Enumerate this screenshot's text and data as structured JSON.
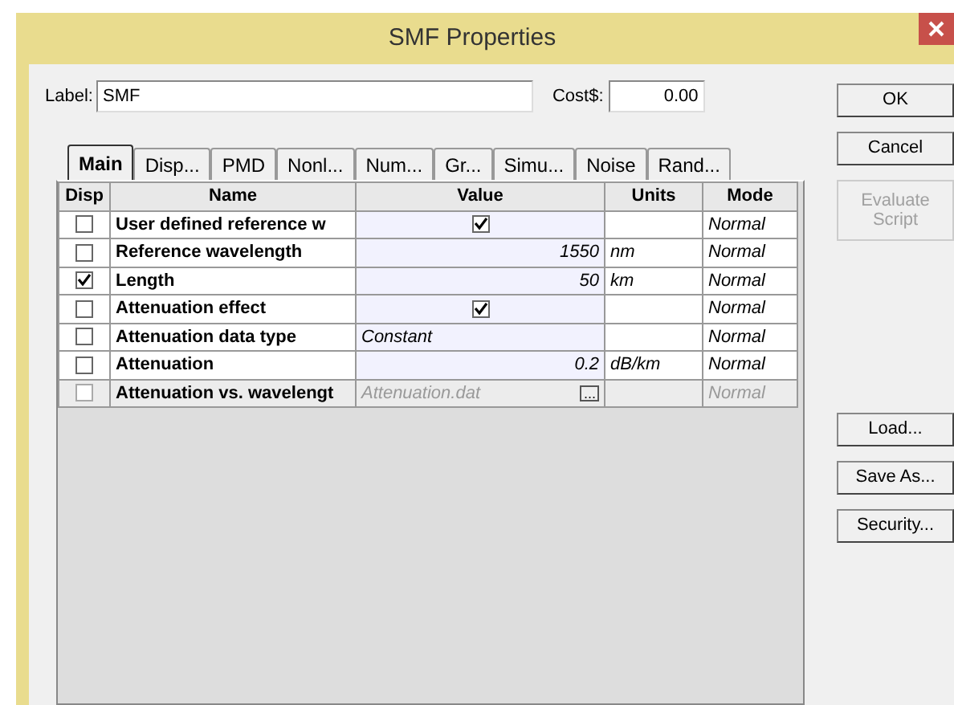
{
  "window": {
    "title": "SMF Properties"
  },
  "label_field": {
    "label": "Label:",
    "value": "SMF"
  },
  "cost_field": {
    "label": "Cost$:",
    "value": "0.00"
  },
  "tabs": [
    {
      "label": "Main",
      "selected": true
    },
    {
      "label": "Disp...",
      "selected": false
    },
    {
      "label": "PMD",
      "selected": false
    },
    {
      "label": "Nonl...",
      "selected": false
    },
    {
      "label": "Num...",
      "selected": false
    },
    {
      "label": "Gr...",
      "selected": false
    },
    {
      "label": "Simu...",
      "selected": false
    },
    {
      "label": "Noise",
      "selected": false
    },
    {
      "label": "Rand...",
      "selected": false
    }
  ],
  "table": {
    "columns": [
      "Disp",
      "Name",
      "Value",
      "Units",
      "Mode"
    ],
    "rows": [
      {
        "disp_checked": false,
        "name": "User defined reference w",
        "kind": "checkbox",
        "value_checked": true,
        "mode": "Normal",
        "disabled": false
      },
      {
        "disp_checked": false,
        "name": "Reference wavelength",
        "kind": "number",
        "value": "1550",
        "units": "nm",
        "mode": "Normal",
        "disabled": false
      },
      {
        "disp_checked": true,
        "name": "Length",
        "kind": "number",
        "value": "50",
        "units": "km",
        "mode": "Normal",
        "disabled": false
      },
      {
        "disp_checked": false,
        "name": "Attenuation effect",
        "kind": "checkbox",
        "value_checked": true,
        "mode": "Normal",
        "disabled": false
      },
      {
        "disp_checked": false,
        "name": "Attenuation data type",
        "kind": "text",
        "value": "Constant",
        "mode": "Normal",
        "disabled": false
      },
      {
        "disp_checked": false,
        "name": "Attenuation",
        "kind": "number",
        "value": "0.2",
        "units": "dB/km",
        "mode": "Normal",
        "disabled": false
      },
      {
        "disp_checked": false,
        "name": "Attenuation vs. wavelengt",
        "kind": "file",
        "value": "Attenuation.dat",
        "browse": "...",
        "mode": "Normal",
        "disabled": true
      }
    ]
  },
  "top_buttons": [
    {
      "label": "OK",
      "disabled": false
    },
    {
      "label": "Cancel",
      "disabled": false
    },
    {
      "label": "Evaluate Script",
      "disabled": true
    }
  ],
  "bottom_buttons": [
    {
      "label": "Load...",
      "disabled": false
    },
    {
      "label": "Save As...",
      "disabled": false
    },
    {
      "label": "Security...",
      "disabled": false
    }
  ]
}
